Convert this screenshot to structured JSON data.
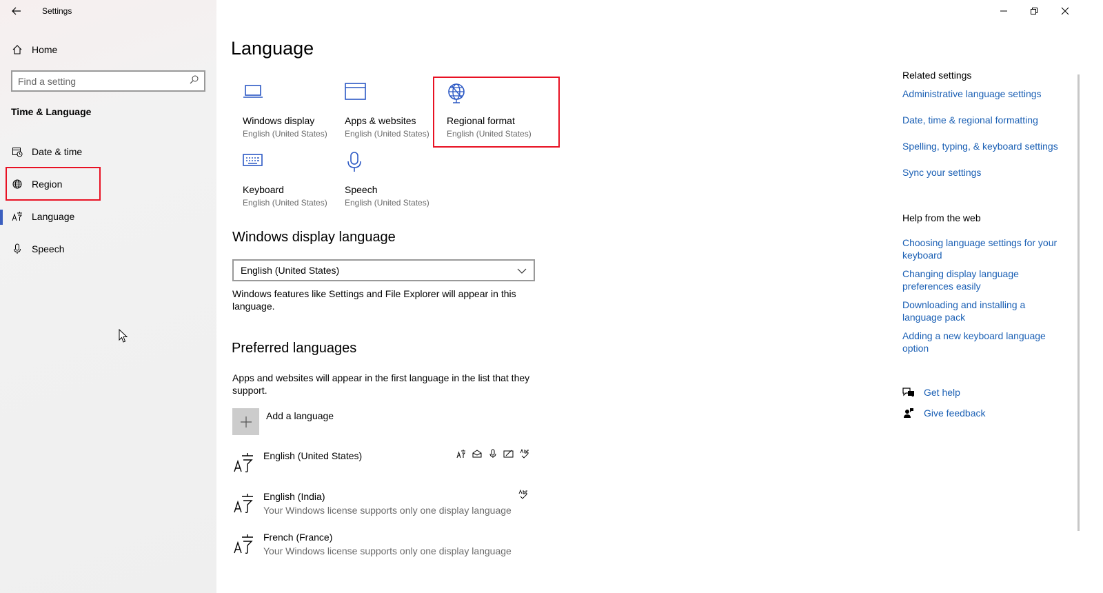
{
  "window": {
    "title": "Settings",
    "controls": {
      "minimize": "minimize-icon",
      "restore": "restore-icon",
      "close": "close-icon"
    }
  },
  "sidebar": {
    "home_label": "Home",
    "search_placeholder": "Find a setting",
    "section_title": "Time & Language",
    "items": [
      {
        "label": "Date & time",
        "icon": "calendar-clock-icon"
      },
      {
        "label": "Region",
        "icon": "globe-icon"
      },
      {
        "label": "Language",
        "icon": "language-icon",
        "active": true
      },
      {
        "label": "Speech",
        "icon": "microphone-icon"
      }
    ]
  },
  "main": {
    "title": "Language",
    "tiles": [
      {
        "name": "Windows display",
        "sub": "English (United States)",
        "icon": "laptop-icon"
      },
      {
        "name": "Apps & websites",
        "sub": "English (United States)",
        "icon": "window-icon"
      },
      {
        "name": "Regional format",
        "sub": "English (United States)",
        "icon": "globe-icon"
      },
      {
        "name": "Keyboard",
        "sub": "English (United States)",
        "icon": "keyboard-icon"
      },
      {
        "name": "Speech",
        "sub": "English (United States)",
        "icon": "microphone-icon"
      }
    ],
    "display_language": {
      "heading": "Windows display language",
      "selected": "English (United States)",
      "description": "Windows features like Settings and File Explorer will appear in this language."
    },
    "preferred": {
      "heading": "Preferred languages",
      "description": "Apps and websites will appear in the first language in the list that they support.",
      "add_label": "Add a language",
      "languages": [
        {
          "name": "English (United States)",
          "sub": ""
        },
        {
          "name": "English (India)",
          "sub": "Your Windows license supports only one display language"
        },
        {
          "name": "French (France)",
          "sub": "Your Windows license supports only one display language"
        }
      ]
    }
  },
  "related": {
    "heading": "Related settings",
    "links": [
      "Administrative language settings",
      "Date, time & regional formatting",
      "Spelling, typing, & keyboard settings",
      "Sync your settings"
    ]
  },
  "help_web": {
    "heading": "Help from the web",
    "links": [
      "Choosing language settings for your keyboard",
      "Changing display language preferences easily",
      "Downloading and installing a language pack",
      "Adding a new keyboard language option"
    ]
  },
  "support": {
    "get_help": "Get help",
    "give_feedback": "Give feedback"
  },
  "colors": {
    "accent": "#1a5fb4",
    "highlight": "#e81123",
    "tile_icon": "#2b58c4"
  }
}
